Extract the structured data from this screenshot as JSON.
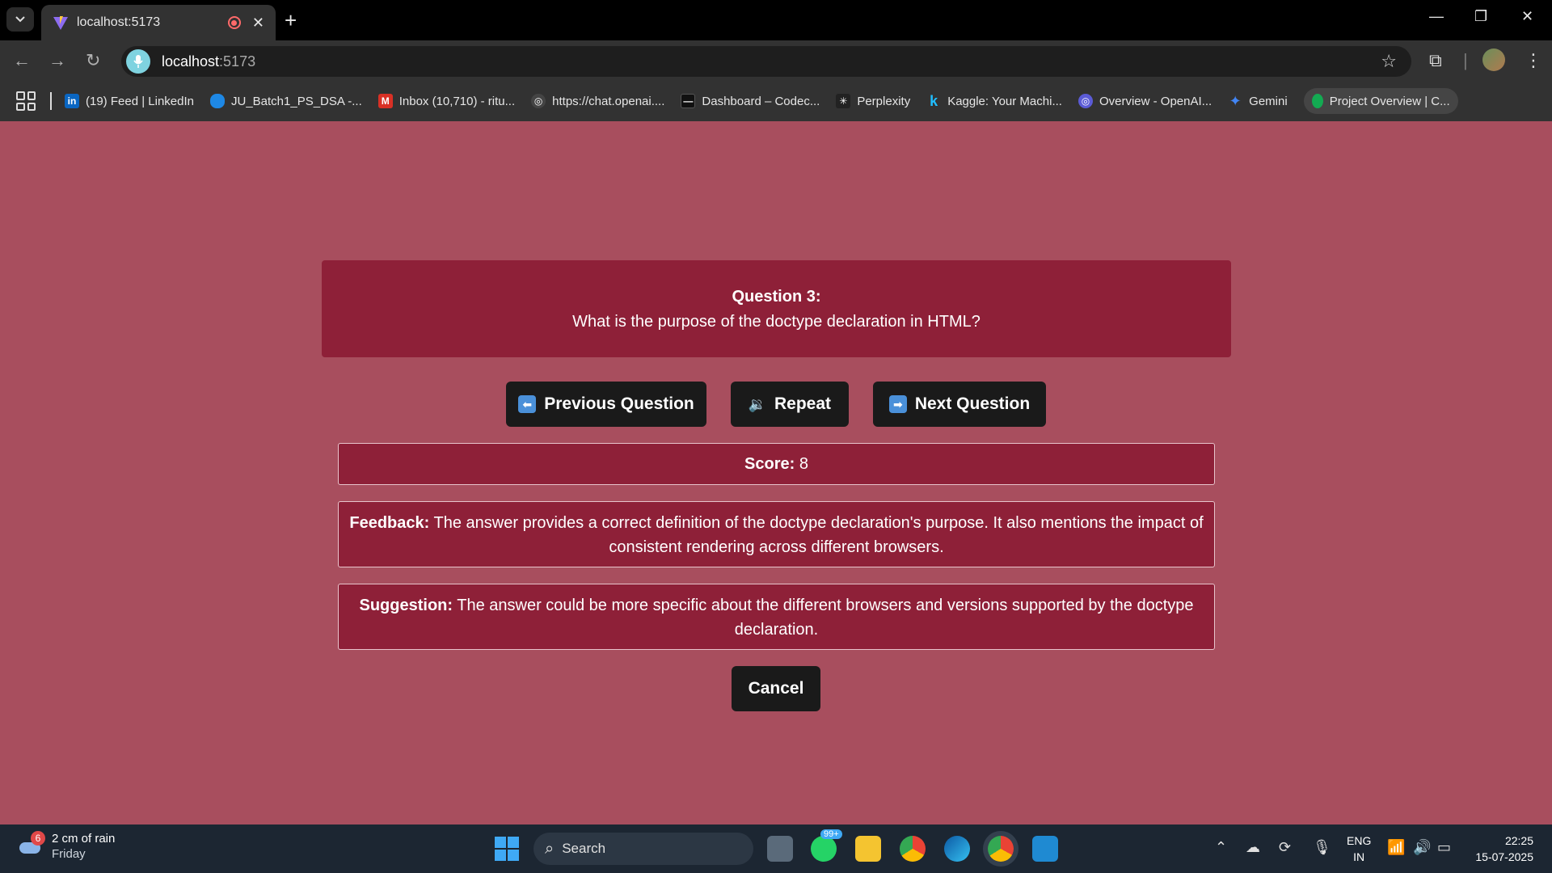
{
  "browser": {
    "tab_title": "localhost:5173",
    "url_host": "localhost",
    "url_port": ":5173"
  },
  "bookmarks": [
    {
      "label": "(19) Feed | LinkedIn",
      "icon": "linkedin-icon",
      "color": "#0a66c2"
    },
    {
      "label": "JU_Batch1_PS_DSA -...",
      "icon": "onedrive-icon",
      "color": "#1e88e5"
    },
    {
      "label": "Inbox (10,710) - ritu...",
      "icon": "gmail-icon",
      "color": "#d93025"
    },
    {
      "label": "https://chat.openai....",
      "icon": "openai-icon",
      "color": "#444444"
    },
    {
      "label": "Dashboard – Codec...",
      "icon": "codec-icon",
      "color": "#111111"
    },
    {
      "label": "Perplexity",
      "icon": "perplexity-icon",
      "color": "#222222"
    },
    {
      "label": "Kaggle: Your Machi...",
      "icon": "kaggle-icon",
      "color": "#20beff"
    },
    {
      "label": "Overview - OpenAI...",
      "icon": "openai-overview-icon",
      "color": "#5b5bd6"
    },
    {
      "label": "Gemini",
      "icon": "gemini-icon",
      "color": "#4285f4"
    },
    {
      "label": "Project Overview | C...",
      "icon": "mongodb-icon",
      "color": "#13aa52"
    }
  ],
  "question": {
    "number_label": "Question 3:",
    "text": "What is the purpose of the doctype declaration in HTML?"
  },
  "controls": {
    "previous": "Previous Question",
    "repeat": "Repeat",
    "next": "Next Question",
    "cancel": "Cancel"
  },
  "result": {
    "score_label": "Score:",
    "score_value": "8",
    "feedback_label": "Feedback:",
    "feedback_text": "The answer provides a correct definition of the doctype declaration's purpose. It also mentions the impact of consistent rendering across different browsers.",
    "suggestion_label": "Suggestion:",
    "suggestion_text": "The answer could be more specific about the different browsers and versions supported by the doctype declaration."
  },
  "taskbar": {
    "weather_badge": "6",
    "weather_title": "2 cm of rain",
    "weather_day": "Friday",
    "search_placeholder": "Search",
    "whatsapp_badge": "99+",
    "lang_top": "ENG",
    "lang_bottom": "IN",
    "time": "22:25",
    "date": "15-07-2025"
  },
  "colors": {
    "page_bg": "#a84e5e",
    "card_bg": "#8e2038",
    "button_bg": "#1a1a1a"
  }
}
